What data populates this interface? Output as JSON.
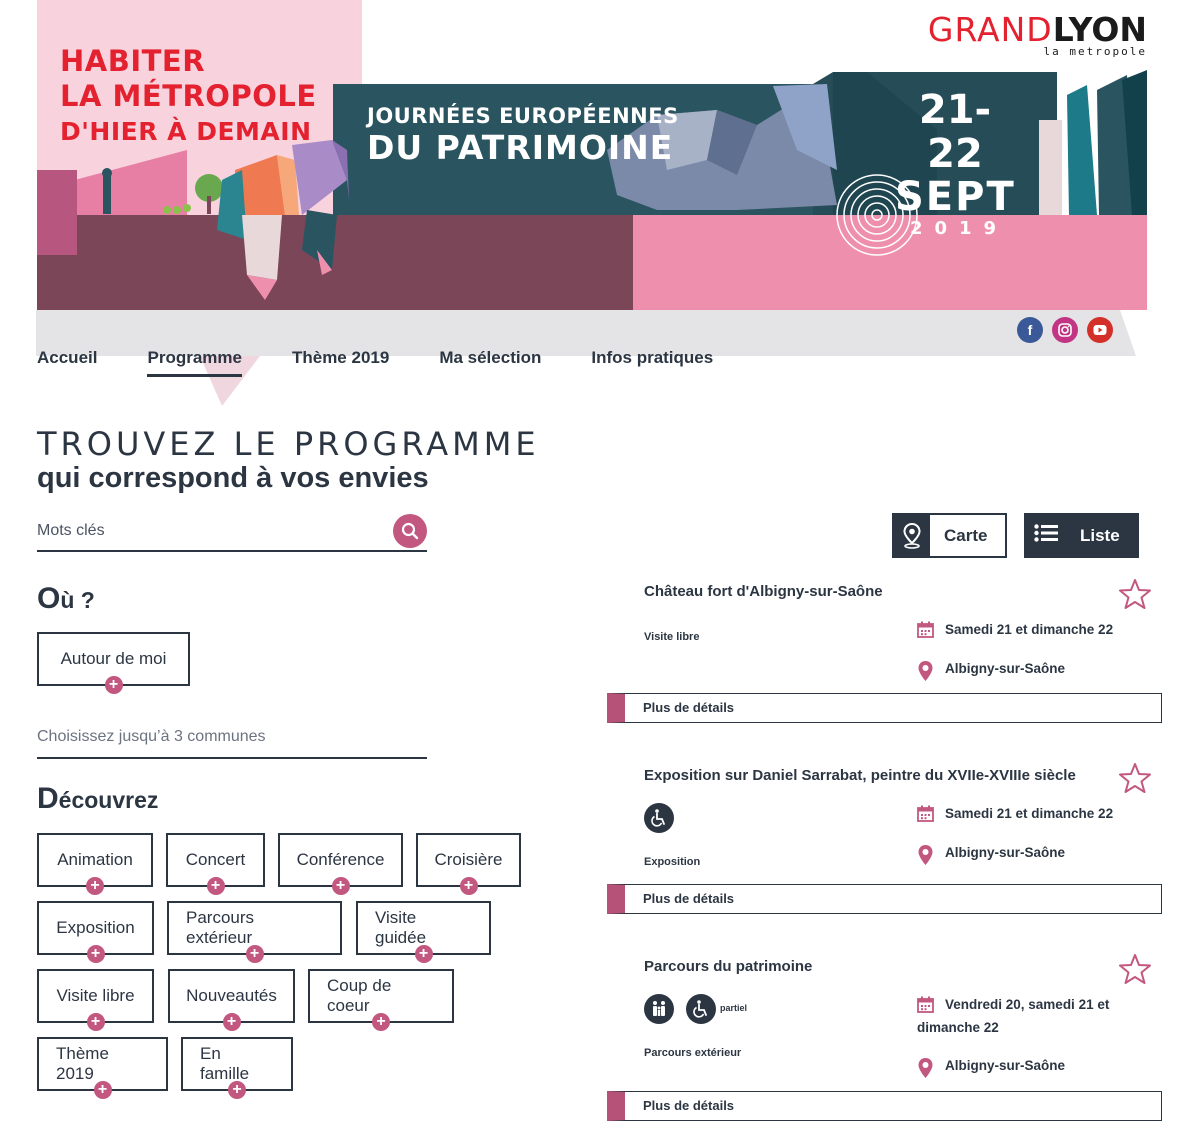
{
  "banner": {
    "habiter_line1": "HABITER",
    "habiter_line2": "LA MÉTROPOLE",
    "habiter_line3": "D'HIER À DEMAIN",
    "jep_line1": "JOURNÉES EUROPÉENNES",
    "jep_line2": "DU PATRIMOINE",
    "dates_line1": "21-22",
    "dates_line2": "SEPT",
    "dates_line3": "2019"
  },
  "logo": {
    "grand": "GRAND",
    "lyon": "LYON",
    "tagline": "la metropole"
  },
  "social": {
    "facebook": "f",
    "instagram": "◎",
    "youtube": "▶"
  },
  "nav": [
    "Accueil",
    "Programme",
    "Thème 2019",
    "Ma sélection",
    "Infos pratiques"
  ],
  "search": {
    "title_line1": "TROUVEZ LE PROGRAMME",
    "title_line2": "qui correspond à vos envies",
    "keywords_placeholder": "Mots clés",
    "where_first": "O",
    "where_rest": "ù ?",
    "around_me": "Autour de moi",
    "communes_placeholder": "Choisissez jusqu’à 3 communes",
    "discover_first": "D",
    "discover_rest": "écouvrez",
    "tags": [
      "Animation",
      "Concert",
      "Conférence",
      "Croisière",
      "Exposition",
      "Parcours extérieur",
      "Visite guidée",
      "Visite libre",
      "Nouveautés",
      "Coup de coeur",
      "Thème 2019",
      "En famille"
    ]
  },
  "view": {
    "map_label": "Carte",
    "list_label": "Liste"
  },
  "results": [
    {
      "title": "Château fort d'Albigny-sur-Saône",
      "type": "Visite libre",
      "date": "Samedi 21 et dimanche 22",
      "place": "Albigny-sur-Saône",
      "details": "Plus de détails"
    },
    {
      "title": "Exposition sur Daniel Sarrabat, peintre du XVIIe-XVIIIe siècle",
      "type": "Exposition",
      "date": "Samedi 21 et dimanche 22",
      "place": "Albigny-sur-Saône",
      "details": "Plus de détails"
    },
    {
      "title": "Parcours du patrimoine",
      "type": "Parcours extérieur",
      "access_note": "partiel",
      "date_line1": "Vendredi 20, samedi 21 et",
      "date_line2": "dimanche 22",
      "place": "Albigny-sur-Saône",
      "details": "Plus de détails"
    }
  ],
  "colors": {
    "accent_pink": "#c2577f",
    "dark_navy": "#2c3643",
    "brand_red": "#e3212f",
    "teal": "#2a5560",
    "plum": "#7a4658",
    "rose": "#ef8fae"
  }
}
